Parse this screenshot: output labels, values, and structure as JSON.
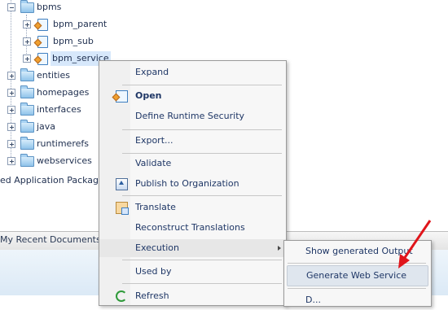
{
  "tree": {
    "items": [
      {
        "label": "bpms"
      },
      {
        "label": "bpm_parent"
      },
      {
        "label": "bpm_sub"
      },
      {
        "label": "bpm_service"
      },
      {
        "label": "entities"
      },
      {
        "label": "homepages"
      },
      {
        "label": "interfaces"
      },
      {
        "label": "java"
      },
      {
        "label": "runtimerefs"
      },
      {
        "label": "webservices"
      }
    ],
    "partial_label": "ed Application Packages"
  },
  "tabbar": {
    "tab_label": "My Recent Documents"
  },
  "context_menu": {
    "items": [
      {
        "label": "Expand"
      },
      {
        "label": "Open",
        "icon": "package-icon"
      },
      {
        "label": "Define Runtime Security"
      },
      {
        "label": "Export..."
      },
      {
        "label": "Validate"
      },
      {
        "label": "Publish to Organization",
        "icon": "publish-icon"
      },
      {
        "label": "Translate",
        "icon": "translate-icon"
      },
      {
        "label": "Reconstruct Translations"
      },
      {
        "label": "Execution"
      },
      {
        "label": "Used by"
      },
      {
        "label": "Refresh",
        "icon": "refresh-icon"
      }
    ]
  },
  "submenu": {
    "items": [
      {
        "label": "Show generated Output"
      },
      {
        "label": "Generate Web Service"
      },
      {
        "label": "D..."
      }
    ]
  },
  "colors": {
    "annotation_arrow": "#e0151b",
    "highlight": "#dfe6ee",
    "text": "#1f3766"
  }
}
